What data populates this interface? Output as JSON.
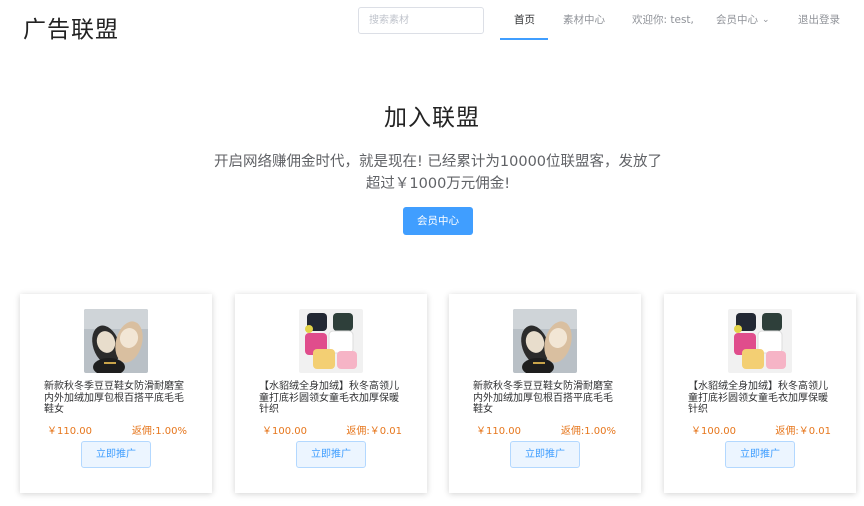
{
  "header": {
    "logo": "广告联盟",
    "search_placeholder": "搜索素材",
    "nav": {
      "home": "首页",
      "materials": "素材中心",
      "welcome": "欢迎你: test,",
      "member": "会员中心",
      "logout": "退出登录"
    }
  },
  "hero": {
    "title": "加入联盟",
    "desc": "开启网络赚佣金时代，就是现在! 已经累计为10000位联盟客，发放了超过￥1000万元佣金!",
    "button": "会员中心"
  },
  "products": [
    {
      "title": "新款秋冬季豆豆鞋女防滑耐磨室内外加绒加厚包根百搭平底毛毛鞋女",
      "price": "￥110.00",
      "commission": "返佣:1.00%",
      "button": "立即推广",
      "image": "shoes"
    },
    {
      "title": "【水貂绒全身加绒】秋冬高领儿童打底衫圆领女童毛衣加厚保暖针织",
      "price": "￥100.00",
      "commission": "返佣:￥0.01",
      "button": "立即推广",
      "image": "sweaters"
    },
    {
      "title": "新款秋冬季豆豆鞋女防滑耐磨室内外加绒加厚包根百搭平底毛毛鞋女",
      "price": "￥110.00",
      "commission": "返佣:1.00%",
      "button": "立即推广",
      "image": "shoes"
    },
    {
      "title": "【水貂绒全身加绒】秋冬高领儿童打底衫圆领女童毛衣加厚保暖针织",
      "price": "￥100.00",
      "commission": "返佣:￥0.01",
      "button": "立即推广",
      "image": "sweaters"
    }
  ],
  "colors": {
    "accent": "#409eff",
    "price": "#e6761c",
    "nav_text": "#909399"
  }
}
